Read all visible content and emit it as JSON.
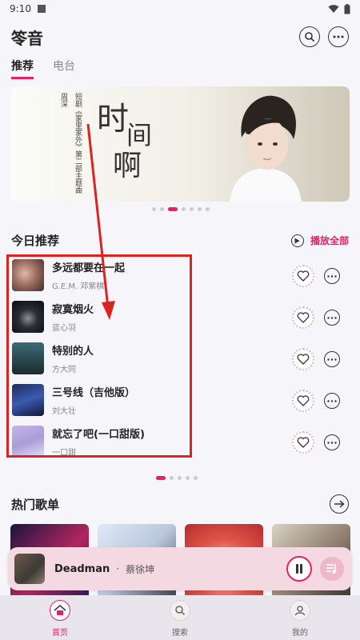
{
  "status": {
    "time": "9:10"
  },
  "app": {
    "title": "笭音"
  },
  "tabs": [
    {
      "label": "推荐"
    },
    {
      "label": "电台"
    }
  ],
  "banner": {
    "credit_artist": "周深",
    "credit_desc": "短剧《家里家外》第二部主题曲",
    "title_chars": [
      "时",
      "间",
      "啊"
    ]
  },
  "daily": {
    "title": "今日推荐",
    "play_all": "播放全部",
    "songs": [
      {
        "title": "多远都要在一起",
        "artist": "G.E.M. 邓紫棋"
      },
      {
        "title": "寂寞烟火",
        "artist": "蓝心羽"
      },
      {
        "title": "特别的人",
        "artist": "方大同"
      },
      {
        "title": "三号线（吉他版）",
        "artist": "刘大壮"
      },
      {
        "title": "就忘了吧(一口甜版)",
        "artist": "一口甜"
      }
    ]
  },
  "hot": {
    "title": "热门歌单"
  },
  "player": {
    "title": "Deadman",
    "separator": "·",
    "artist": "蔡徐坤"
  },
  "nav": [
    {
      "label": "首页"
    },
    {
      "label": "搜索"
    },
    {
      "label": "我的"
    }
  ],
  "colors": {
    "accent": "#e91e63",
    "highlight": "#dd2222"
  }
}
